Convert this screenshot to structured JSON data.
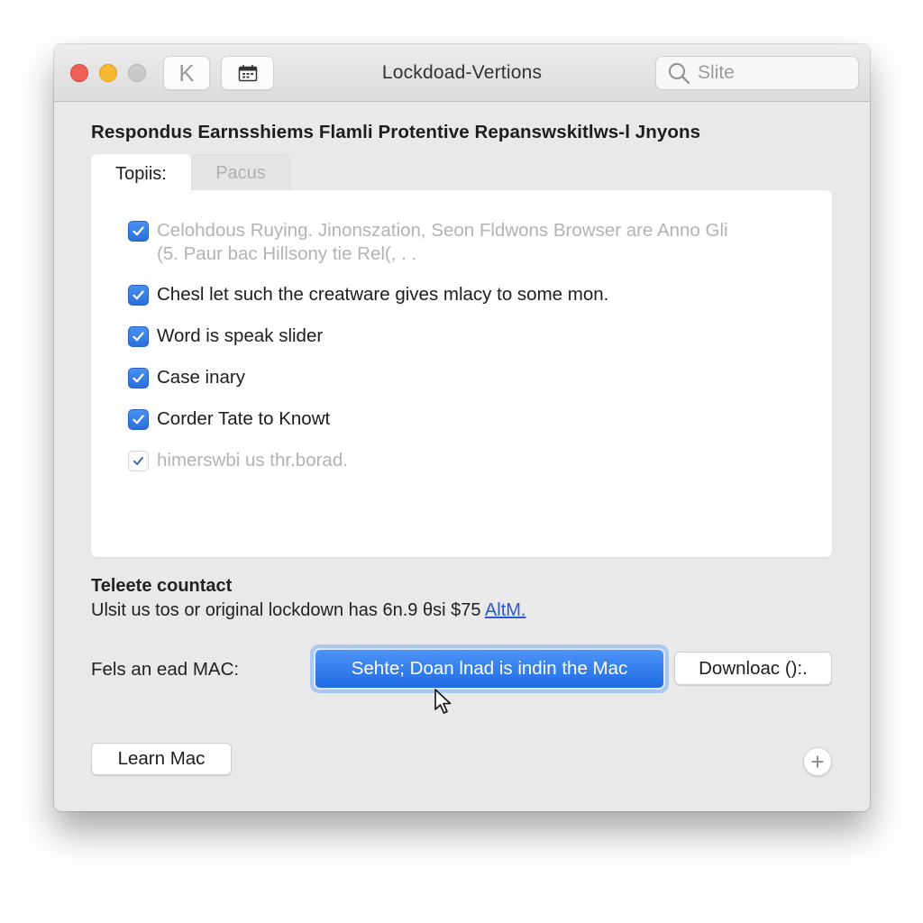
{
  "window": {
    "title": "Lockdoad-Vertions",
    "search": {
      "placeholder": "Slite",
      "value": ""
    },
    "toolbar": {
      "back_label": "K",
      "calendar_icon": "calendar-icon"
    },
    "traffic_lights": [
      "close",
      "minimize",
      "zoom"
    ]
  },
  "heading": "Respondus Earnsshiems Flamli Protentive Repanswskitlws-l Jnyons",
  "tabs": [
    {
      "label": "Topiis:",
      "active": true
    },
    {
      "label": "Pacus",
      "active": false
    }
  ],
  "options": [
    {
      "label": "Celohdous Ruying. Jinonszation, Seon Fldwons Browser are Anno Gli",
      "label_line2": "(5. Paur bac Hillsony tie Rel(, . .",
      "checked": true,
      "dimmed": true
    },
    {
      "label": "Chesl let such the creatware gives mlacy to some mon.",
      "checked": true,
      "dimmed": false
    },
    {
      "label": "Word is speak slider",
      "checked": true,
      "dimmed": false
    },
    {
      "label": "Case inary",
      "checked": true,
      "dimmed": false
    },
    {
      "label": "Corder Tate to Knowt",
      "checked": true,
      "dimmed": false
    },
    {
      "label": "himerswbi us thr.borad.",
      "checked": true,
      "dimmed": true
    }
  ],
  "contact": {
    "title": "Teleete countact",
    "text": "Ulsit us tos or original lockdown has 6n.9 θsi $75",
    "link": "AltM."
  },
  "mac_row": {
    "label": "Fels an ead MAC:",
    "primary_button": "Sehte; Doan lnad is indin the Mac",
    "secondary_button": "Downloac ():."
  },
  "footer": {
    "learn_button": "Learn Mac",
    "add_button": "+"
  },
  "colors": {
    "accent": "#2a6fdc",
    "link": "#2a5ad4",
    "close": "#ed5f57",
    "minimize": "#f6b92f",
    "zoom": "#c9c9c9"
  }
}
